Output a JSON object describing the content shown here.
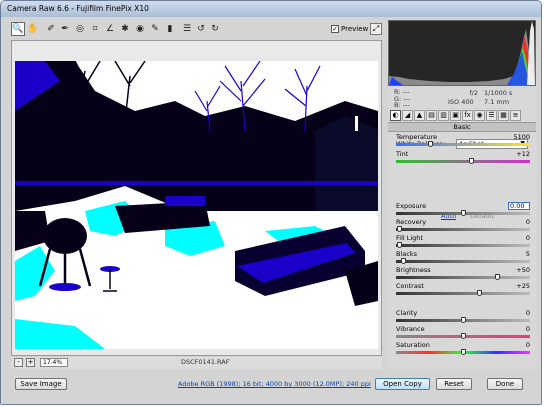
{
  "window": {
    "title": "Camera Raw 6.6  -  Fujifilm FinePix X10"
  },
  "toolbar": {
    "tools": [
      "zoom-tool",
      "hand-tool",
      "white-balance-tool",
      "color-sampler-tool",
      "targeted-adjustment-tool",
      "crop-tool",
      "straighten-tool",
      "spot-removal-tool",
      "red-eye-tool",
      "adjustment-brush-tool",
      "graduated-filter-tool",
      "preferences-tool",
      "rotate-ccw-tool",
      "rotate-cw-tool"
    ],
    "preview_label": "Preview",
    "preview_checked": true
  },
  "image": {
    "filename": "DSCF0141.RAF"
  },
  "status": {
    "zoom_value": "17.4%",
    "zoom_out": "-",
    "zoom_in": "+"
  },
  "readout": {
    "r_label": "R:",
    "r_value": "---",
    "g_label": "G:",
    "g_value": "---",
    "b_label": "B:",
    "b_value": "---",
    "aperture": "f/2",
    "shutter": "1/1000 s",
    "iso": "ISO 400",
    "focal": "7.1 mm"
  },
  "panel": {
    "section_title": "Basic",
    "white_balance": {
      "label": "White Balance:",
      "value": "As Shot"
    },
    "auto_label": "Auto",
    "default_label": "Default",
    "sliders": [
      {
        "key": "temperature",
        "label": "Temperature",
        "value": "5100",
        "level": 0.25
      },
      {
        "key": "tint",
        "label": "Tint",
        "value": "+12",
        "level": 0.56
      },
      {
        "key": "exposure",
        "label": "Exposure",
        "value": "0.00",
        "level": 0.5,
        "editing": true
      },
      {
        "key": "recovery",
        "label": "Recovery",
        "value": "0",
        "level": 0.0
      },
      {
        "key": "fill-light",
        "label": "Fill Light",
        "value": "0",
        "level": 0.0
      },
      {
        "key": "blacks",
        "label": "Blacks",
        "value": "5",
        "level": 0.05
      },
      {
        "key": "brightness",
        "label": "Brightness",
        "value": "+50",
        "level": 0.75
      },
      {
        "key": "contrast",
        "label": "Contrast",
        "value": "+25",
        "level": 0.62
      },
      {
        "key": "clarity",
        "label": "Clarity",
        "value": "0",
        "level": 0.5
      },
      {
        "key": "vibrance",
        "label": "Vibrance",
        "value": "0",
        "level": 0.5
      },
      {
        "key": "saturation",
        "label": "Saturation",
        "value": "0",
        "level": 0.5
      }
    ]
  },
  "footer": {
    "save_label": "Save Image",
    "info_link": "Adobe RGB (1998); 16 bit; 4000 by 3000 (12.0MP); 240 ppi",
    "open_label": "Open Copy",
    "reset_label": "Reset",
    "done_label": "Done"
  },
  "colors": {
    "accent": "#3a6ed8",
    "photo_clip_shadow": "#1a00c8",
    "photo_clip_highlight": "#00ffff"
  }
}
